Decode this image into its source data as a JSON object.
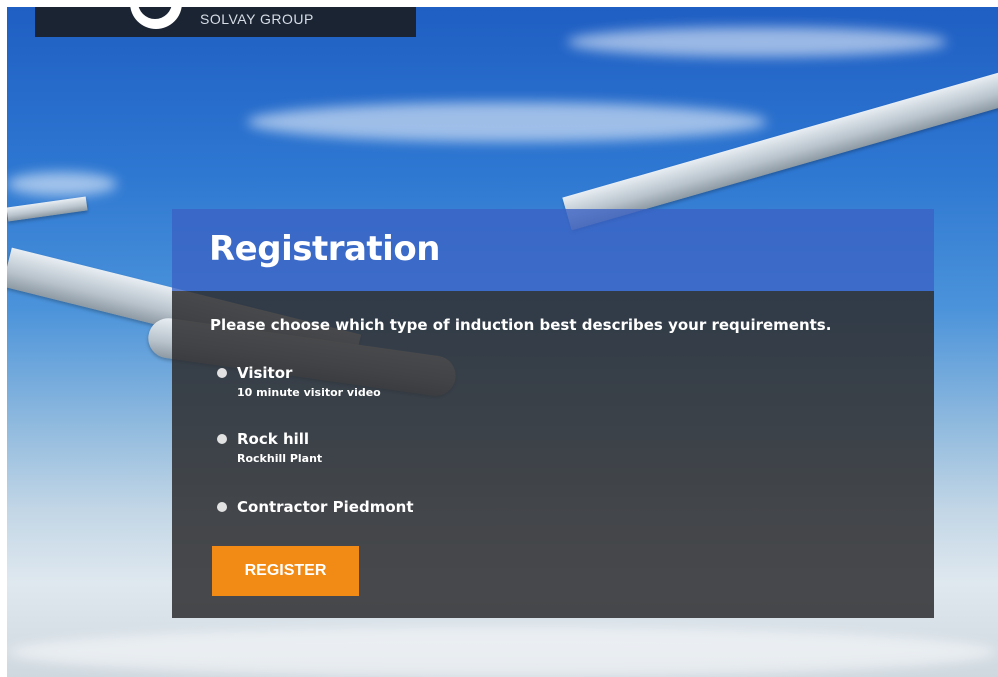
{
  "logo": {
    "text": "SOLVAY GROUP"
  },
  "registration": {
    "title": "Registration",
    "prompt": "Please choose which type of induction best describes your requirements.",
    "options": [
      {
        "label": "Visitor",
        "sublabel": "10 minute visitor video"
      },
      {
        "label": "Rock hill",
        "sublabel": "Rockhill Plant"
      },
      {
        "label": "Contractor Piedmont",
        "sublabel": ""
      }
    ],
    "register_label": "REGISTER"
  },
  "colors": {
    "header": "#3a62c4",
    "panel": "#2d2d30",
    "button": "#f28a16",
    "logo_bar": "#1a2433"
  }
}
